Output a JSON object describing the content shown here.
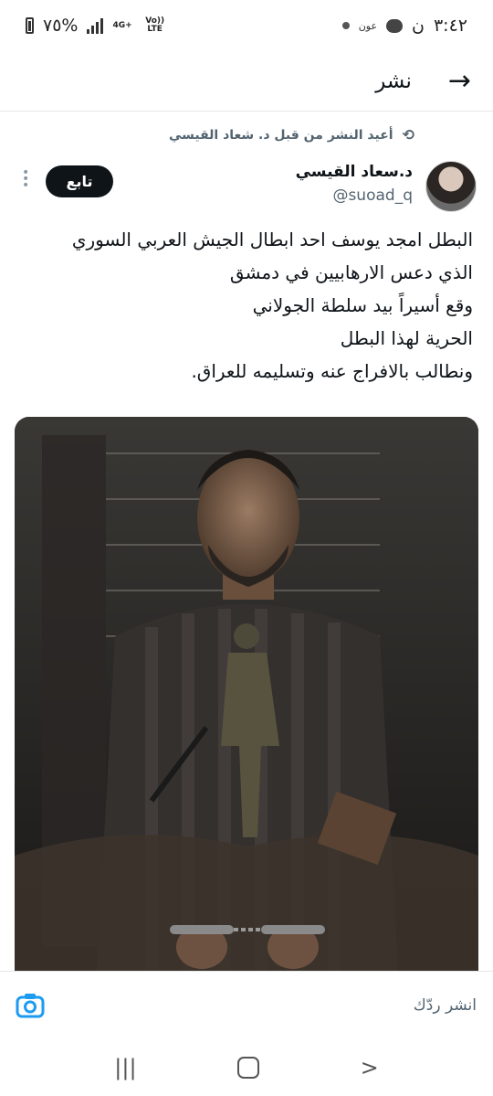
{
  "status_bar": {
    "time": "٣:٤٢",
    "network_name": "عون",
    "battery": "٧٥%",
    "network_type_top": "4G+",
    "network_type_side": "Vo)) LTE"
  },
  "header": {
    "title": "نشر",
    "back_icon": "arrow-right-icon"
  },
  "retweet": {
    "text": "أعيد النشر من قبل د. شعاد القيسي",
    "icon": "retweet-icon"
  },
  "author": {
    "display_name": "د.سعاد القيسي",
    "handle": "@suoad_q"
  },
  "follow_label": "تابع",
  "tweet_lines": [
    "البطل امجد يوسف احد ابطال الجيش العربي السوري",
    "الذي دعس الارهابيين في دمشق",
    "وقع أسيراً بيد سلطة الجولاني",
    "الحرية لهذا البطل",
    "ونطالب بالافراج عنه وتسليمه للعراق."
  ],
  "reply": {
    "placeholder": "انشر ردّك",
    "camera_icon": "camera-icon"
  },
  "colors": {
    "accent": "#1d9bf0",
    "text": "#0f1419",
    "muted": "#536471"
  }
}
